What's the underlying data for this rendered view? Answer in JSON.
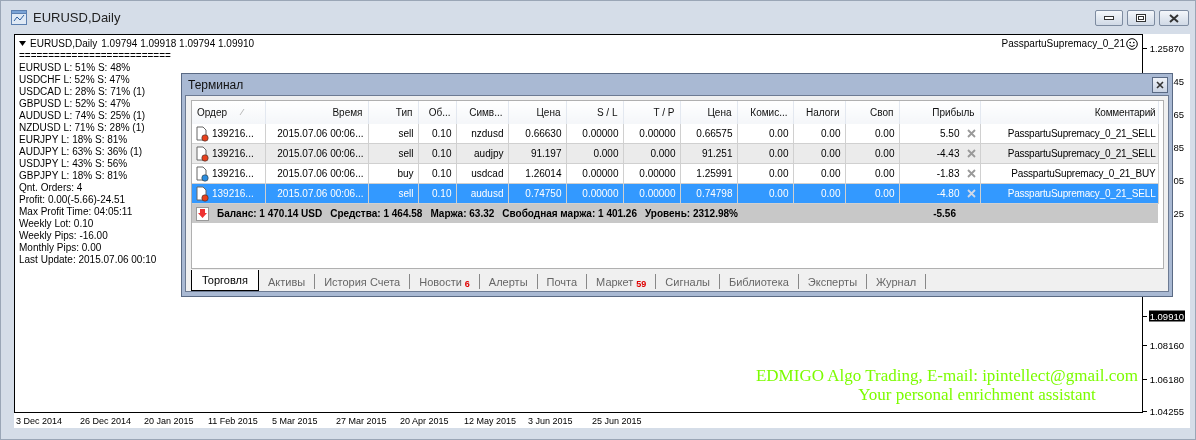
{
  "window": {
    "title": "EURUSD,Daily"
  },
  "chart": {
    "symbol": "EURUSD,Daily",
    "ohlc": "1.09794 1.09918 1.09794 1.09910",
    "expert": "PasspartuSupremacy_0_21",
    "separator": "==========================",
    "info_lines": [
      "EURUSD L: 51% S: 48%",
      "USDCHF L: 52% S: 47%",
      "USDCAD L: 28% S: 71% (1)",
      "GBPUSD L: 52% S: 47%",
      "AUDUSD L: 74% S: 25% (1)",
      "NZDUSD L: 71% S: 28% (1)",
      "EURJPY L: 18% S: 81%",
      "AUDJPY L: 63% S: 36% (1)",
      "USDJPY L: 43% S: 56%",
      "GBPJPY L: 18% S: 81%",
      "Qnt. Orders: 4",
      "Profit: 0.00(-5.66)-24.51",
      "Max Profit Time: 04:05:11",
      "Weekly Lot: 0.10",
      "Weekly Pips: -16.00",
      "Monthly Pips: 0.00",
      "Last Update: 2015.07.06 00:10"
    ],
    "price_labels": [
      {
        "text": "1.25870",
        "kind": "tick"
      },
      {
        "text": "45",
        "kind": "fragment"
      },
      {
        "text": "65",
        "kind": "fragment"
      },
      {
        "text": "85",
        "kind": "fragment"
      },
      {
        "text": "05",
        "kind": "fragment"
      },
      {
        "text": "25",
        "kind": "fragment"
      },
      {
        "text": "1.09910",
        "kind": "current"
      },
      {
        "text": "1.08160",
        "kind": "tick"
      },
      {
        "text": "1.06180",
        "kind": "tick"
      },
      {
        "text": "1.04255",
        "kind": "tick"
      }
    ],
    "dates": [
      "3 Dec 2014",
      "26 Dec 2014",
      "20 Jan 2015",
      "11 Feb 2015",
      "5 Mar 2015",
      "27 Mar 2015",
      "20 Apr 2015",
      "12 May 2015",
      "3 Jun 2015",
      "25 Jun 2015"
    ],
    "footer_lines": [
      "EDMIGO Algo Trading, E-mail: ipintellect@gmail.com",
      "Your personal enrichment assistant"
    ]
  },
  "terminal": {
    "title": "Терминал",
    "columns": [
      "Ордер",
      "Время",
      "Тип",
      "Об...",
      "Симв...",
      "Цена",
      "S / L",
      "T / P",
      "Цена",
      "Комис...",
      "Налоги",
      "Своп",
      "Прибыль",
      "Комментарий"
    ],
    "rows": [
      {
        "kind": "sell",
        "selected": false,
        "cells": [
          "139216...",
          "2015.07.06 00:06...",
          "sell",
          "0.10",
          "nzdusd",
          "0.66630",
          "0.00000",
          "0.00000",
          "0.66575",
          "0.00",
          "0.00",
          "0.00",
          "5.50",
          "PasspartuSupremacy_0_21_SELL"
        ]
      },
      {
        "kind": "sell",
        "selected": false,
        "cells": [
          "139216...",
          "2015.07.06 00:06...",
          "sell",
          "0.10",
          "audjpy",
          "91.197",
          "0.000",
          "0.000",
          "91.251",
          "0.00",
          "0.00",
          "0.00",
          "-4.43",
          "PasspartuSupremacy_0_21_SELL"
        ]
      },
      {
        "kind": "buy",
        "selected": false,
        "cells": [
          "139216...",
          "2015.07.06 00:06...",
          "buy",
          "0.10",
          "usdcad",
          "1.26014",
          "0.00000",
          "0.00000",
          "1.25991",
          "0.00",
          "0.00",
          "0.00",
          "-1.83",
          "PasspartuSupremacy_0_21_BUY"
        ]
      },
      {
        "kind": "sell",
        "selected": true,
        "cells": [
          "139216...",
          "2015.07.06 00:06...",
          "sell",
          "0.10",
          "audusd",
          "0.74750",
          "0.00000",
          "0.00000",
          "0.74798",
          "0.00",
          "0.00",
          "0.00",
          "-4.80",
          "PasspartuSupremacy_0_21_SELL"
        ]
      }
    ],
    "summary": {
      "items": [
        "Баланс: 1 470.14 USD",
        "Средства: 1 464.58",
        "Маржа: 63.32",
        "Свободная маржа: 1 401.26",
        "Уровень: 2312.98%"
      ],
      "profit": "-5.56"
    },
    "tabs": [
      {
        "label": "Торговля",
        "selected": true
      },
      {
        "label": "Активы",
        "selected": false
      },
      {
        "label": "История Счета",
        "selected": false
      },
      {
        "label": "Новости",
        "badge": "6",
        "selected": false
      },
      {
        "label": "Алерты",
        "selected": false
      },
      {
        "label": "Почта",
        "selected": false
      },
      {
        "label": "Маркет",
        "badge": "59",
        "selected": false
      },
      {
        "label": "Сигналы",
        "selected": false
      },
      {
        "label": "Библиотека",
        "selected": false
      },
      {
        "label": "Эксперты",
        "selected": false
      },
      {
        "label": "Журнал",
        "selected": false
      }
    ]
  }
}
